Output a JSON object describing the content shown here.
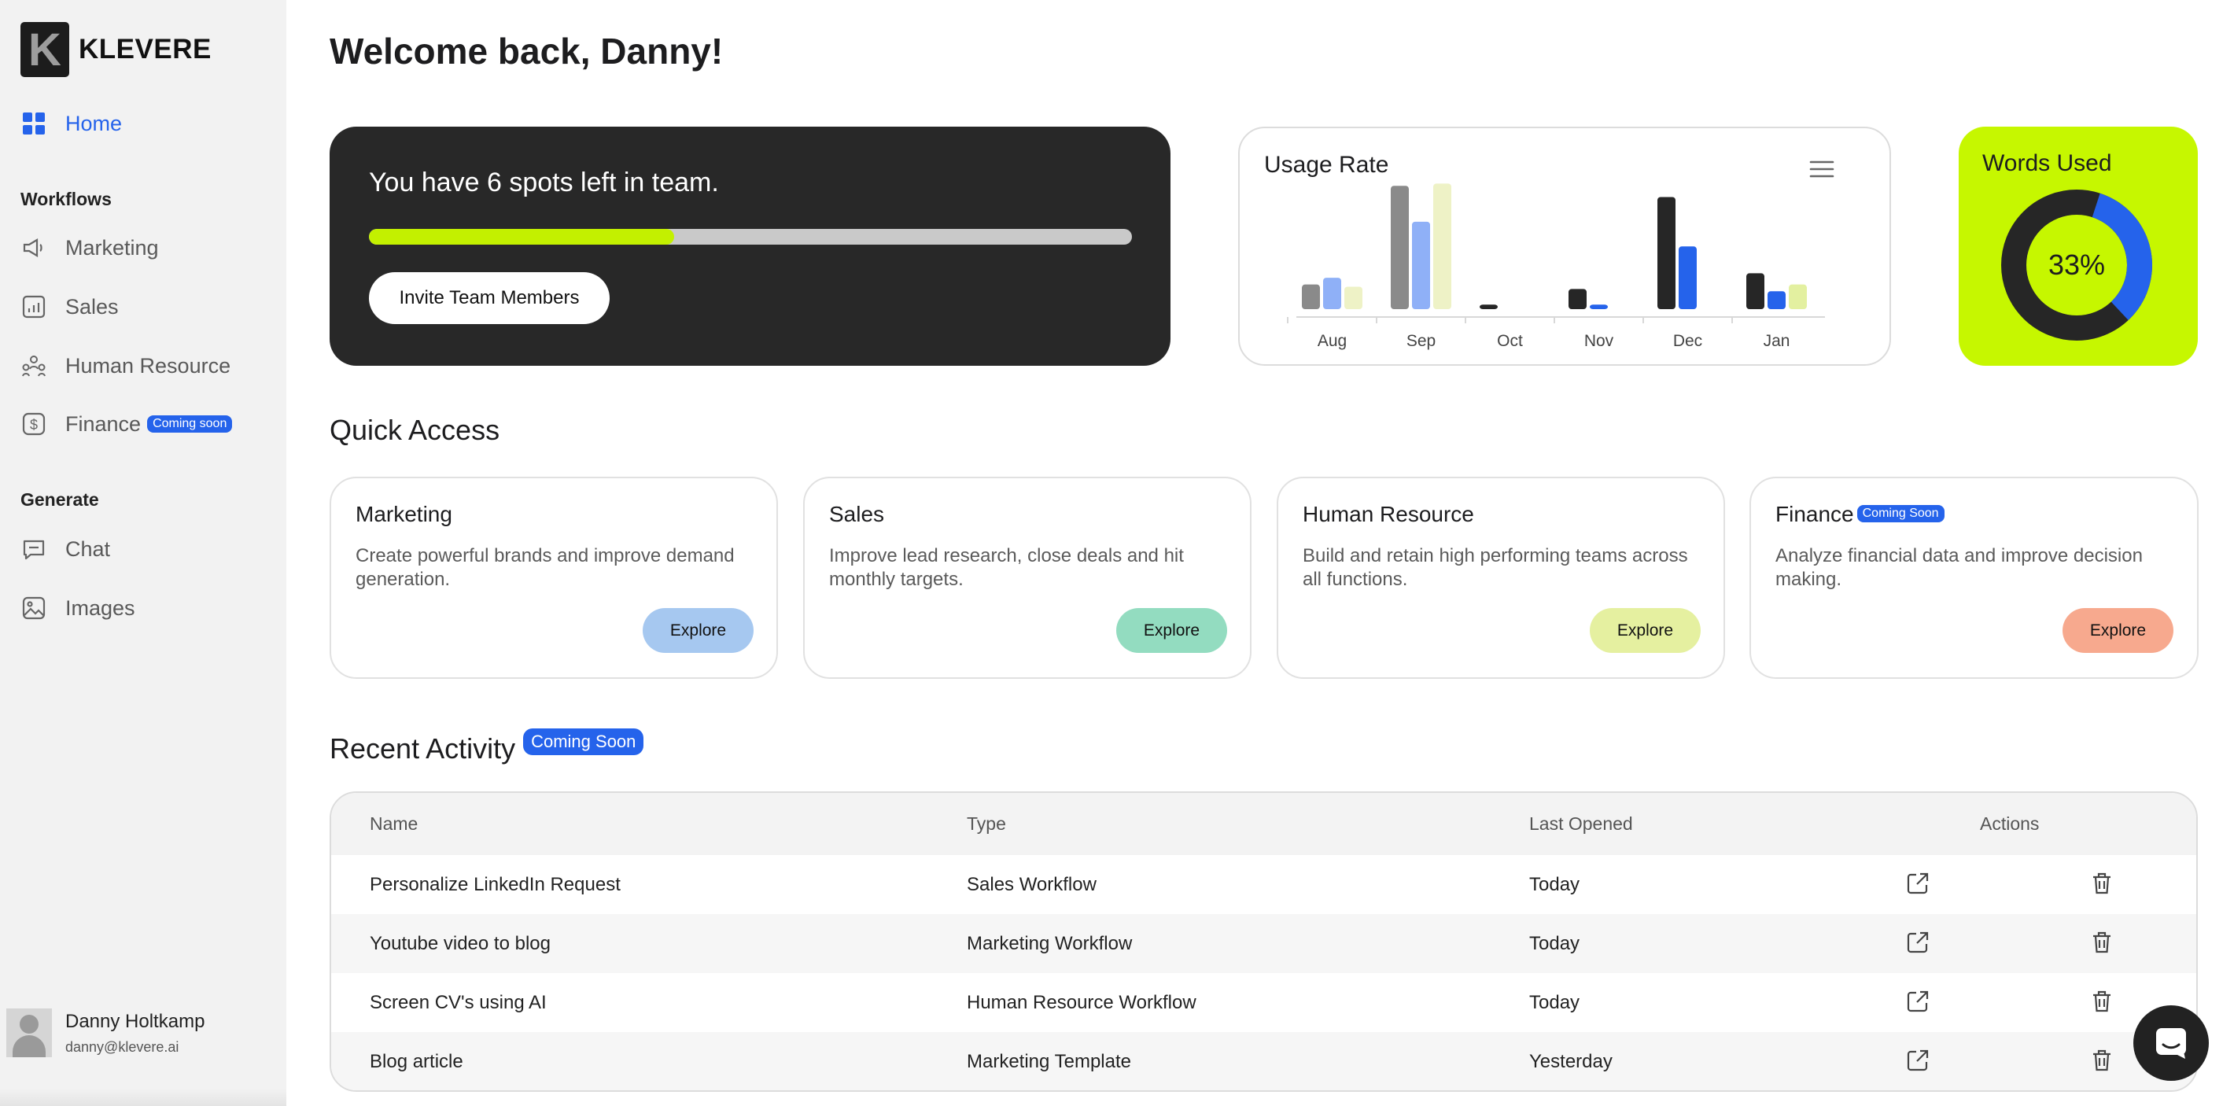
{
  "brand": {
    "logo_letter": "K",
    "name": "KLEVERE"
  },
  "sidebar": {
    "home": {
      "label": "Home",
      "icon": "grid-icon"
    },
    "workflows_heading": "Workflows",
    "workflows": [
      {
        "label": "Marketing",
        "icon": "megaphone-icon"
      },
      {
        "label": "Sales",
        "icon": "chart-icon"
      },
      {
        "label": "Human Resource",
        "icon": "people-icon"
      },
      {
        "label": "Finance",
        "icon": "dollar-icon",
        "badge": "Coming soon"
      }
    ],
    "generate_heading": "Generate",
    "generate": [
      {
        "label": "Chat",
        "icon": "chat-icon"
      },
      {
        "label": "Images",
        "icon": "image-icon"
      }
    ],
    "user": {
      "name": "Danny Holtkamp",
      "email": "danny@klevere.ai"
    }
  },
  "main": {
    "title": "Welcome back, Danny!",
    "team_card": {
      "text": "You have 6 spots left in team.",
      "progress": 0.4,
      "button": "Invite Team Members"
    },
    "usage_card": {
      "title": "Usage Rate"
    },
    "words_card": {
      "title": "Words Used",
      "percent_label": "33%",
      "percent": 0.33
    },
    "quick_access": {
      "title": "Quick Access",
      "cards": [
        {
          "title": "Marketing",
          "desc": "Create powerful brands and improve demand generation.",
          "button": "Explore",
          "button_color": "#a6c8f0"
        },
        {
          "title": "Sales",
          "desc": "Improve lead research, close deals and hit monthly targets.",
          "button": "Explore",
          "button_color": "#93dcc0"
        },
        {
          "title": "Human Resource",
          "desc": "Build and retain high performing teams across all functions.",
          "button": "Explore",
          "button_color": "#e5f0a0"
        },
        {
          "title": "Finance",
          "badge": "Coming Soon",
          "desc": "Analyze financial data and improve decision making.",
          "button": "Explore",
          "button_color": "#f7a98e"
        }
      ]
    },
    "recent": {
      "title": "Recent Activity",
      "badge": "Coming Soon",
      "columns": [
        "Name",
        "Type",
        "Last Opened",
        "Actions"
      ],
      "rows": [
        {
          "name": "Personalize LinkedIn Request",
          "type": "Sales Workflow",
          "last": "Today"
        },
        {
          "name": "Youtube video to blog",
          "type": "Marketing Workflow",
          "last": "Today"
        },
        {
          "name": "Screen CV's using AI",
          "type": "Human Resource Workflow",
          "last": "Today"
        },
        {
          "name": "Blog article",
          "type": "Marketing Template",
          "last": "Yesterday"
        }
      ]
    }
  },
  "colors": {
    "accent": "#2563eb",
    "lime": "#c6f700",
    "dark": "#282828"
  },
  "chart_data": {
    "type": "bar",
    "title": "Usage Rate",
    "categories": [
      "Aug",
      "Sep",
      "Oct",
      "Nov",
      "Dec",
      "Jan"
    ],
    "series": [
      {
        "values": [
          11,
          55,
          2,
          9,
          50,
          16
        ],
        "color": "#8a8a8a"
      },
      {
        "values": [
          14,
          39,
          0,
          2,
          28,
          8
        ],
        "color": "#8fb0f7"
      },
      {
        "values": [
          10,
          56,
          0,
          0,
          0,
          11
        ],
        "color": "#eef2c6"
      }
    ],
    "colors_by_category": {
      "Oct": [
        "#262626",
        "#262626",
        "#262626"
      ],
      "Nov": [
        "#262626",
        "#2563eb",
        "#2563eb"
      ],
      "Dec": [
        "#262626",
        "#2563eb",
        "#2563eb"
      ],
      "Jan": [
        "#262626",
        "#2563eb",
        "#e3f0a0"
      ]
    },
    "grid": false,
    "legend": "none"
  }
}
